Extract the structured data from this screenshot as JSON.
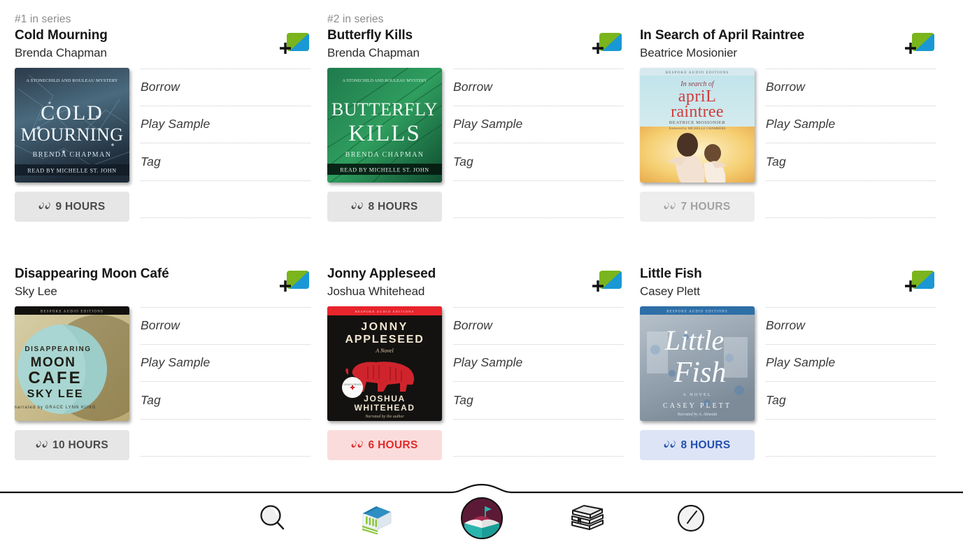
{
  "app": {
    "accent_green": "#7ab51d",
    "accent_blue": "#1a98d5",
    "logo_maroon": "#5c1a36",
    "logo_teal": "#2cb5ae"
  },
  "books": [
    {
      "series_label": "#1 in series",
      "title": "Cold Mourning",
      "author": "Brenda Chapman",
      "cover": {
        "kicker": "A STONECHILD AND ROULEAU MYSTERY",
        "line1": "COLD",
        "line2": "MOURNING",
        "byline": "BRENDA CHAPMAN",
        "narrator": "READ BY MICHELLE ST. JOHN"
      },
      "duration": "9 HOURS",
      "duration_style": "gray",
      "actions": [
        "Borrow",
        "Play Sample",
        "Tag",
        ""
      ],
      "add_icon": "add-to-list-icon"
    },
    {
      "series_label": "#2 in series",
      "title": "Butterfly Kills",
      "author": "Brenda Chapman",
      "cover": {
        "kicker": "A STONECHILD AND ROULEAU MYSTERY",
        "line1": "BUTTERFLY",
        "line2": "KILLS",
        "byline": "BRENDA CHAPMAN",
        "narrator": "READ BY MICHELLE ST. JOHN"
      },
      "duration": "8 HOURS",
      "duration_style": "gray",
      "actions": [
        "Borrow",
        "Play Sample",
        "Tag",
        ""
      ],
      "add_icon": "add-to-list-icon"
    },
    {
      "series_label": "",
      "title": "In Search of April Raintree",
      "author": "Beatrice Mosionier",
      "cover": {
        "kicker": "BESPOKE AUDIO EDITIONS",
        "line1": "In search of",
        "line2": "apriL",
        "line3": "raintree",
        "byline": "BEATRICE MOSIONIER",
        "narrator": "Foreword by MICHELLE CHAMBERS"
      },
      "duration": "7 HOURS",
      "duration_style": "gray-muted",
      "actions": [
        "Borrow",
        "Play Sample",
        "Tag",
        ""
      ],
      "add_icon": "add-to-list-icon"
    },
    {
      "series_label": "",
      "title": "Disappearing Moon Café",
      "author": "Sky Lee",
      "cover": {
        "kicker": "BESPOKE AUDIO EDITIONS",
        "line1": "DISAPPEARING",
        "line2": "MOON",
        "line3": "CAFE",
        "byline": "SKY LEE",
        "narrator": "narrated by GRACE LYNN KUNG"
      },
      "duration": "10 HOURS",
      "duration_style": "gray",
      "actions": [
        "Borrow",
        "Play Sample",
        "Tag",
        ""
      ],
      "add_icon": "add-to-list-icon"
    },
    {
      "series_label": "",
      "title": "Jonny Appleseed",
      "author": "Joshua Whitehead",
      "cover": {
        "kicker": "BESPOKE AUDIO EDITIONS",
        "line1": "JONNY",
        "line2": "APPLESEED",
        "line3": "A Novel",
        "byline": "JOSHUA WHITEHEAD",
        "narrator": "Narrated by the author",
        "seal": "CANADA READS"
      },
      "duration": "6 HOURS",
      "duration_style": "pink",
      "actions": [
        "Borrow",
        "Play Sample",
        "Tag",
        ""
      ],
      "add_icon": "add-to-list-icon"
    },
    {
      "series_label": "",
      "title": "Little Fish",
      "author": "Casey Plett",
      "cover": {
        "kicker": "BESPOKE AUDIO EDITIONS",
        "line1": "Little",
        "line2": "Fish",
        "line3": "A NOVEL",
        "byline": "CASEY PLETT",
        "narrator": "Narrated by A. Almeida"
      },
      "duration": "8 HOURS",
      "duration_style": "blue",
      "actions": [
        "Borrow",
        "Play Sample",
        "Tag",
        ""
      ],
      "add_icon": "add-to-list-icon"
    }
  ],
  "nav": {
    "items": [
      {
        "name": "search-icon",
        "label": "Search"
      },
      {
        "name": "library-icon",
        "label": "Library"
      },
      {
        "name": "home-logo-icon",
        "label": "Home"
      },
      {
        "name": "bookshelf-icon",
        "label": "Shelf"
      },
      {
        "name": "clock-icon",
        "label": "Timeline"
      }
    ]
  }
}
